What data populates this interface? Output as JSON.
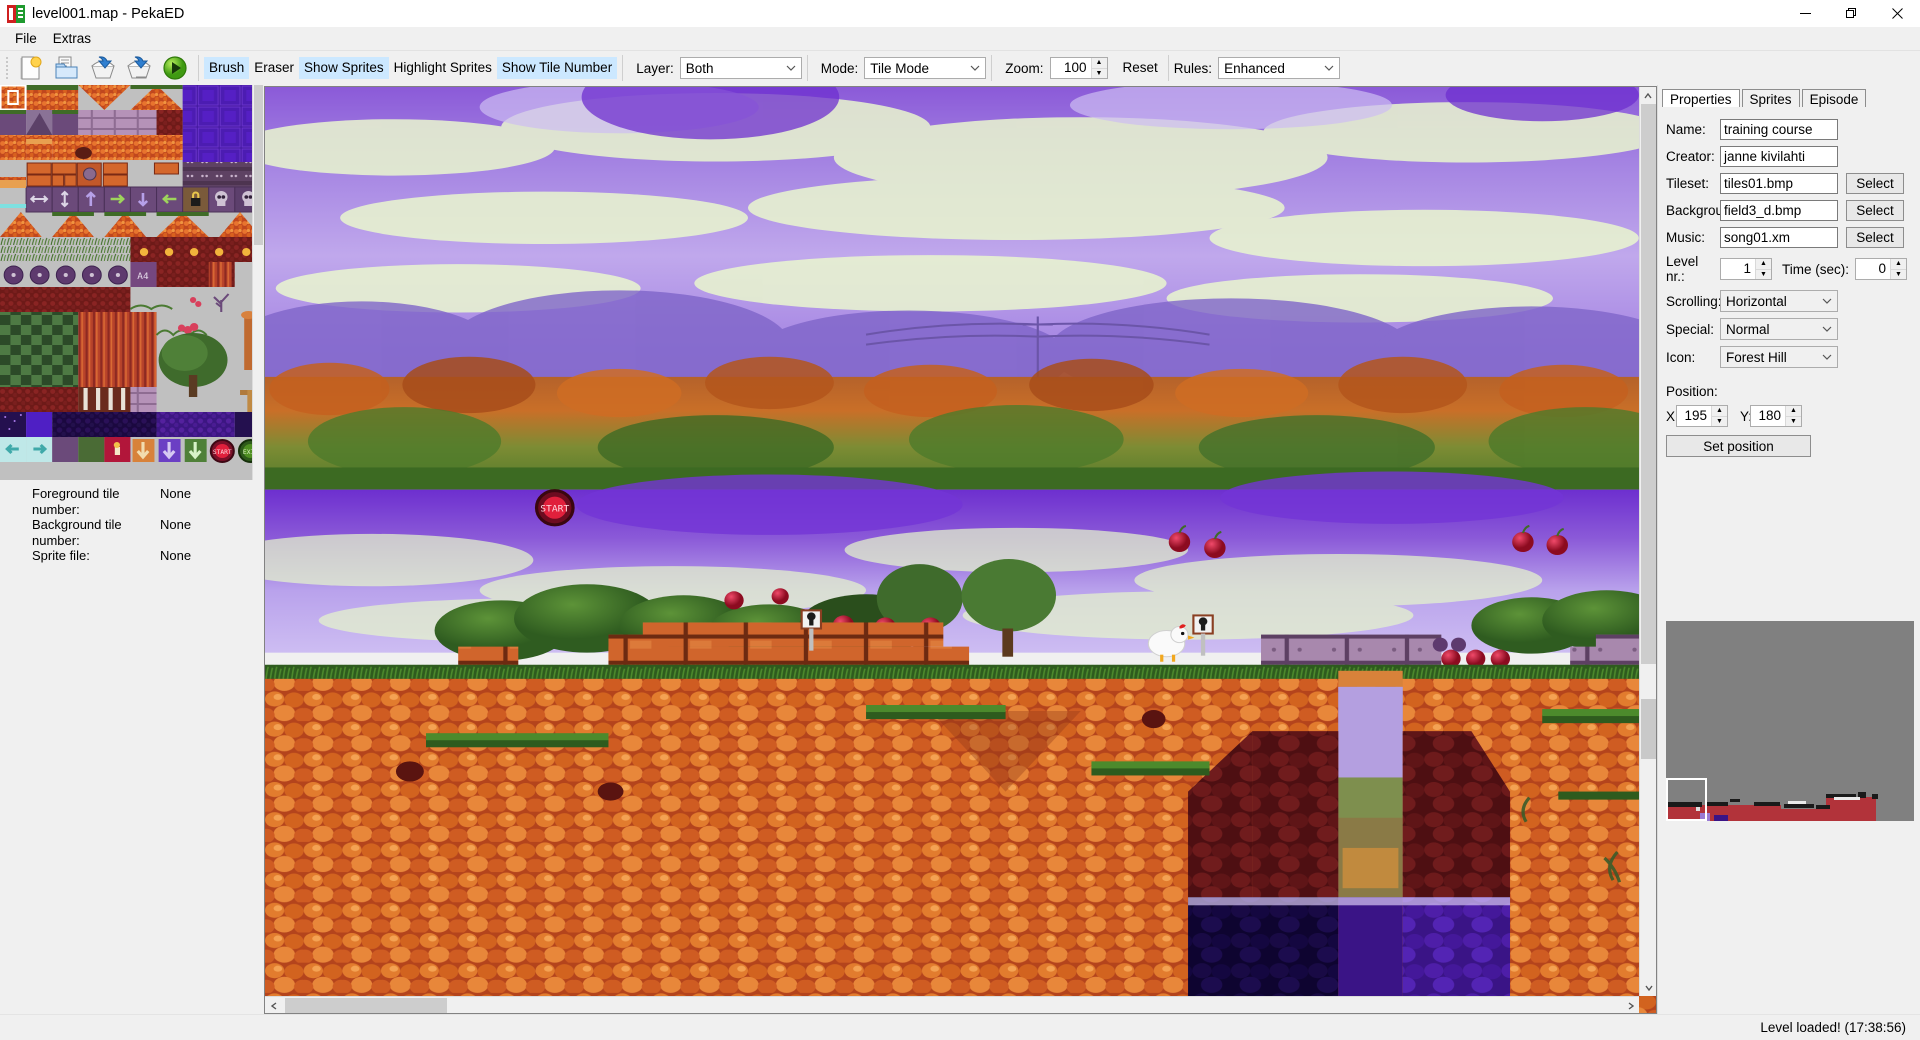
{
  "window": {
    "title": "level001.map - PekaED",
    "icon": "pekaed-logo-icon",
    "minimize": "—",
    "restore": "❐",
    "close": "✕"
  },
  "menubar": {
    "items": [
      {
        "label": "File"
      },
      {
        "label": "Extras"
      }
    ]
  },
  "toolbar": {
    "buttons": [
      {
        "name": "new-file-button",
        "icon": "new-document-icon",
        "label": "New"
      },
      {
        "name": "open-file-button",
        "icon": "open-folder-icon",
        "label": "Open"
      },
      {
        "name": "save-file-button",
        "icon": "save-disk-icon",
        "label": "Save"
      },
      {
        "name": "save-as-button",
        "icon": "save-as-disk-icon",
        "label": "Save As"
      },
      {
        "name": "run-button",
        "icon": "play-circle-icon",
        "label": "Run"
      }
    ],
    "toggles": [
      {
        "label": "Brush",
        "active": true
      },
      {
        "label": "Eraser",
        "active": false
      },
      {
        "label": "Show Sprites",
        "active": true
      },
      {
        "label": "Highlight Sprites",
        "active": false
      },
      {
        "label": "Show Tile Number",
        "active": true
      }
    ],
    "layer_label": "Layer:",
    "layer_value": "Both",
    "mode_label": "Mode:",
    "mode_value": "Tile Mode",
    "zoom_label": "Zoom:",
    "zoom_value": "100",
    "reset_label": "Reset",
    "rules_label": "Rules:",
    "rules_value": "Enhanced"
  },
  "left_panel": {
    "tileset_name": "tiles01.bmp",
    "selected_tile": "0",
    "info": [
      {
        "key": "Foreground tile number:",
        "value": "None"
      },
      {
        "key": "Background tile number:",
        "value": "None"
      },
      {
        "key": "Sprite file:",
        "value": "None"
      }
    ]
  },
  "right_panel": {
    "tabs": [
      {
        "label": "Properties",
        "active": true
      },
      {
        "label": "Sprites",
        "active": false
      },
      {
        "label": "Episode",
        "active": false
      }
    ],
    "fields": {
      "name_label": "Name:",
      "name_value": "training course",
      "creator_label": "Creator:",
      "creator_value": "janne kivilahti",
      "tileset_label": "Tileset:",
      "tileset_value": "tiles01.bmp",
      "tileset_select": "Select",
      "background_label": "Background:",
      "background_value": "field3_d.bmp",
      "background_select": "Select",
      "music_label": "Music:",
      "music_value": "song01.xm",
      "music_select": "Select",
      "levelnr_label": "Level nr.:",
      "levelnr_value": "1",
      "time_label": "Time (sec):",
      "time_value": "0",
      "scrolling_label": "Scrolling:",
      "scrolling_value": "Horizontal",
      "special_label": "Special:",
      "special_value": "Normal",
      "icon_label": "Icon:",
      "icon_value": "Forest Hill",
      "position_label": "Position:",
      "x_label": "X:",
      "x_value": "195",
      "y_label": "Y:",
      "y_value": "180",
      "set_position": "Set position"
    }
  },
  "statusbar": {
    "message": "Level loaded! (17:38:56)"
  },
  "colors": {
    "accent": "#cce8ff",
    "sky_purple": "#8a5fd6",
    "rock_orange": "#d4622a",
    "grass_green": "#4d7a2e",
    "minimap_bg": "#808080",
    "minimap_terrain": "#b2333a",
    "window_bg": "#f0f0f0"
  }
}
